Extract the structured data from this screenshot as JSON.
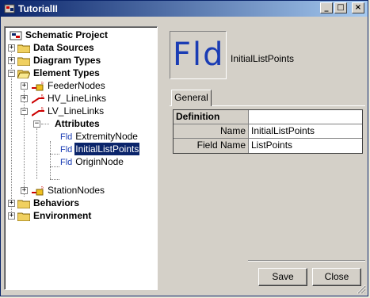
{
  "window": {
    "title": "TutorialII"
  },
  "tree": {
    "root": "Schematic Project",
    "data_sources": "Data Sources",
    "diagram_types": "Diagram Types",
    "element_types": "Element Types",
    "feeder_nodes": "FeederNodes",
    "hv_linelinks": "HV_LineLinks",
    "lv_linelinks": "LV_LineLinks",
    "attributes": "Attributes",
    "extremity_node": "ExtremityNode",
    "initial_list_points": "InitialListPoints",
    "origin_node": "OriginNode",
    "station_nodes": "StationNodes",
    "behaviors": "Behaviors",
    "environment": "Environment",
    "fld_badge": "Fld"
  },
  "header": {
    "icon_text": "Fld",
    "name": "InitialListPoints"
  },
  "tabs": [
    {
      "label": "General"
    }
  ],
  "properties": {
    "section": "Definition",
    "rows": [
      {
        "key": "Name",
        "value": "InitialListPoints"
      },
      {
        "key": "Field Name",
        "value": "ListPoints"
      }
    ]
  },
  "buttons": {
    "save": "Save",
    "close": "Close"
  },
  "colors": {
    "title_start": "#0a246a",
    "title_end": "#a6caf0",
    "selection": "#0a246a",
    "field_blue": "#1a3cb4",
    "face": "#d4d0c8"
  }
}
